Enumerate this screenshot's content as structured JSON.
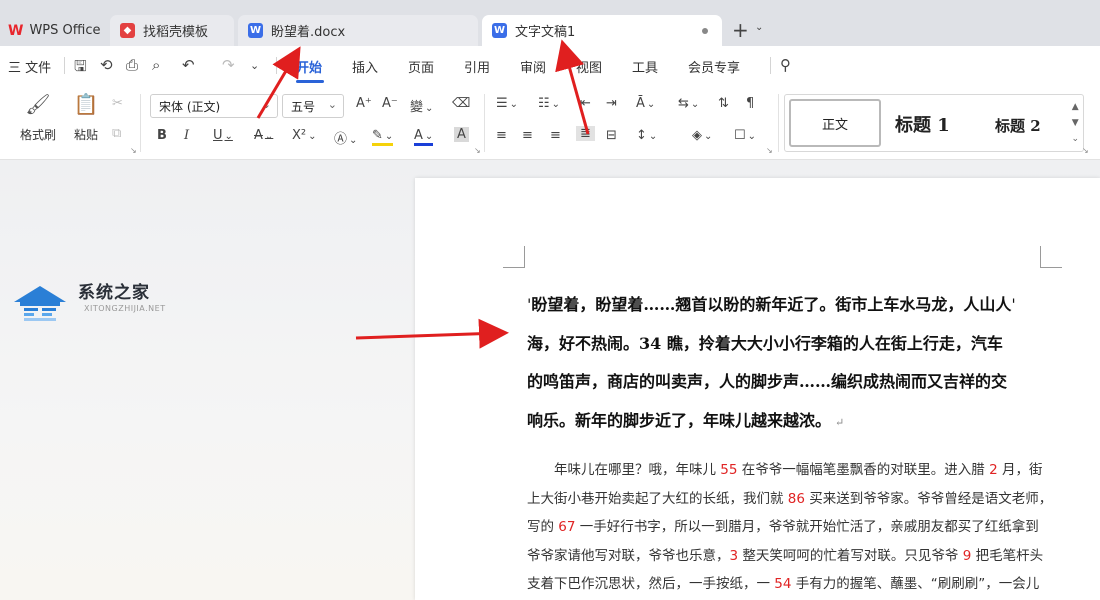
{
  "tabs": {
    "wps": {
      "label": "WPS Office",
      "mark": "W"
    },
    "store": {
      "label": "找稻壳模板"
    },
    "doc1": {
      "label": "盼望着.docx"
    },
    "doc2": {
      "label": "文字文稿1"
    },
    "plus": "+"
  },
  "menu": {
    "file": "三 文件",
    "items": [
      "开始",
      "插入",
      "页面",
      "引用",
      "审阅",
      "视图",
      "工具",
      "会员专享"
    ],
    "active_index": 0
  },
  "ribbon": {
    "format_painter": "格式刷",
    "paste": "粘贴",
    "font_name": "宋体 (正文)",
    "font_size": "五号",
    "styles": {
      "normal": "正文",
      "heading1": "标题 1",
      "heading2": "标题 2"
    },
    "bold": "B",
    "italic": "I",
    "underline": "U",
    "superscript": "X²",
    "char_shade": "A"
  },
  "watermark": {
    "title": "系统之家",
    "subtitle": "XITONGZHIJIA.NET"
  },
  "document": {
    "bold_lines": [
      "盼望着，盼望着……翘首以盼的新年近了。街市上车水马龙，人山人",
      "海，好不热闹。34 瞧，拎着大大小小行李箱的人在街上行走，汽车",
      "的鸣笛声，商店的叫卖声，人的脚步声……编织成热闹而又吉祥的交",
      "响乐。新年的脚步近了，年味儿越来越浓。"
    ],
    "normal_lines": [
      [
        {
          "t": "　　年味儿在哪里？哦，年味儿 "
        },
        {
          "t": "55",
          "red": true
        },
        {
          "t": " 在爷爷一幅幅笔墨飘香的对联里。进入腊 "
        },
        {
          "t": "2",
          "red": true
        },
        {
          "t": " 月，街"
        }
      ],
      [
        {
          "t": "上大街小巷开始卖起了大红的长纸，我们就 "
        },
        {
          "t": "86",
          "red": true
        },
        {
          "t": " 买来送到爷爷家。爷爷曾经是语文老师，"
        }
      ],
      [
        {
          "t": "写的 "
        },
        {
          "t": "67",
          "red": true
        },
        {
          "t": " 一手好行书字，所以一到腊月，爷爷就开始忙活了，亲戚朋友都买了红纸拿到"
        }
      ],
      [
        {
          "t": "爷爷家请他写对联，爷爷也乐意，"
        },
        {
          "t": "3",
          "red": true
        },
        {
          "t": " 整天笑呵呵的忙着写对联。只见爷爷 "
        },
        {
          "t": "9",
          "red": true
        },
        {
          "t": " 把毛笔杆头"
        }
      ],
      [
        {
          "t": "支着下巴作沉思状，然后，一手按纸，一 "
        },
        {
          "t": "54",
          "red": true
        },
        {
          "t": " 手有力的握笔、蘸墨、“刷刷刷”，一会儿"
        }
      ]
    ]
  },
  "colors": {
    "accent": "#2a63d8",
    "arrow": "#e01f1f",
    "highlight_number": "#e02424"
  }
}
